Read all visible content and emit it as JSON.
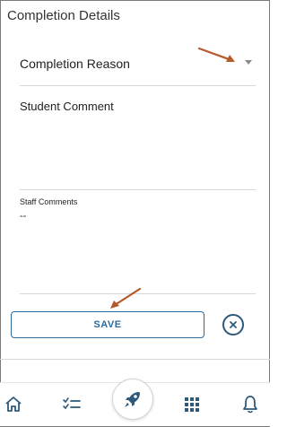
{
  "header": {
    "title": "Completion Details"
  },
  "form": {
    "completion_reason_label": "Completion Reason",
    "student_comment_label": "Student Comment",
    "staff_comments_label": "Staff Comments",
    "staff_comments_value": "--"
  },
  "actions": {
    "save_label": "SAVE"
  },
  "colors": {
    "accent": "#2d6b9c",
    "annotation_arrow": "#b5592a",
    "icon": "#2d5a7b"
  },
  "bottom_nav": {
    "items": [
      {
        "icon": "home-icon"
      },
      {
        "icon": "checklist-icon"
      },
      {
        "icon": "rocket-icon"
      },
      {
        "icon": "grid-icon"
      },
      {
        "icon": "bell-icon"
      }
    ]
  }
}
